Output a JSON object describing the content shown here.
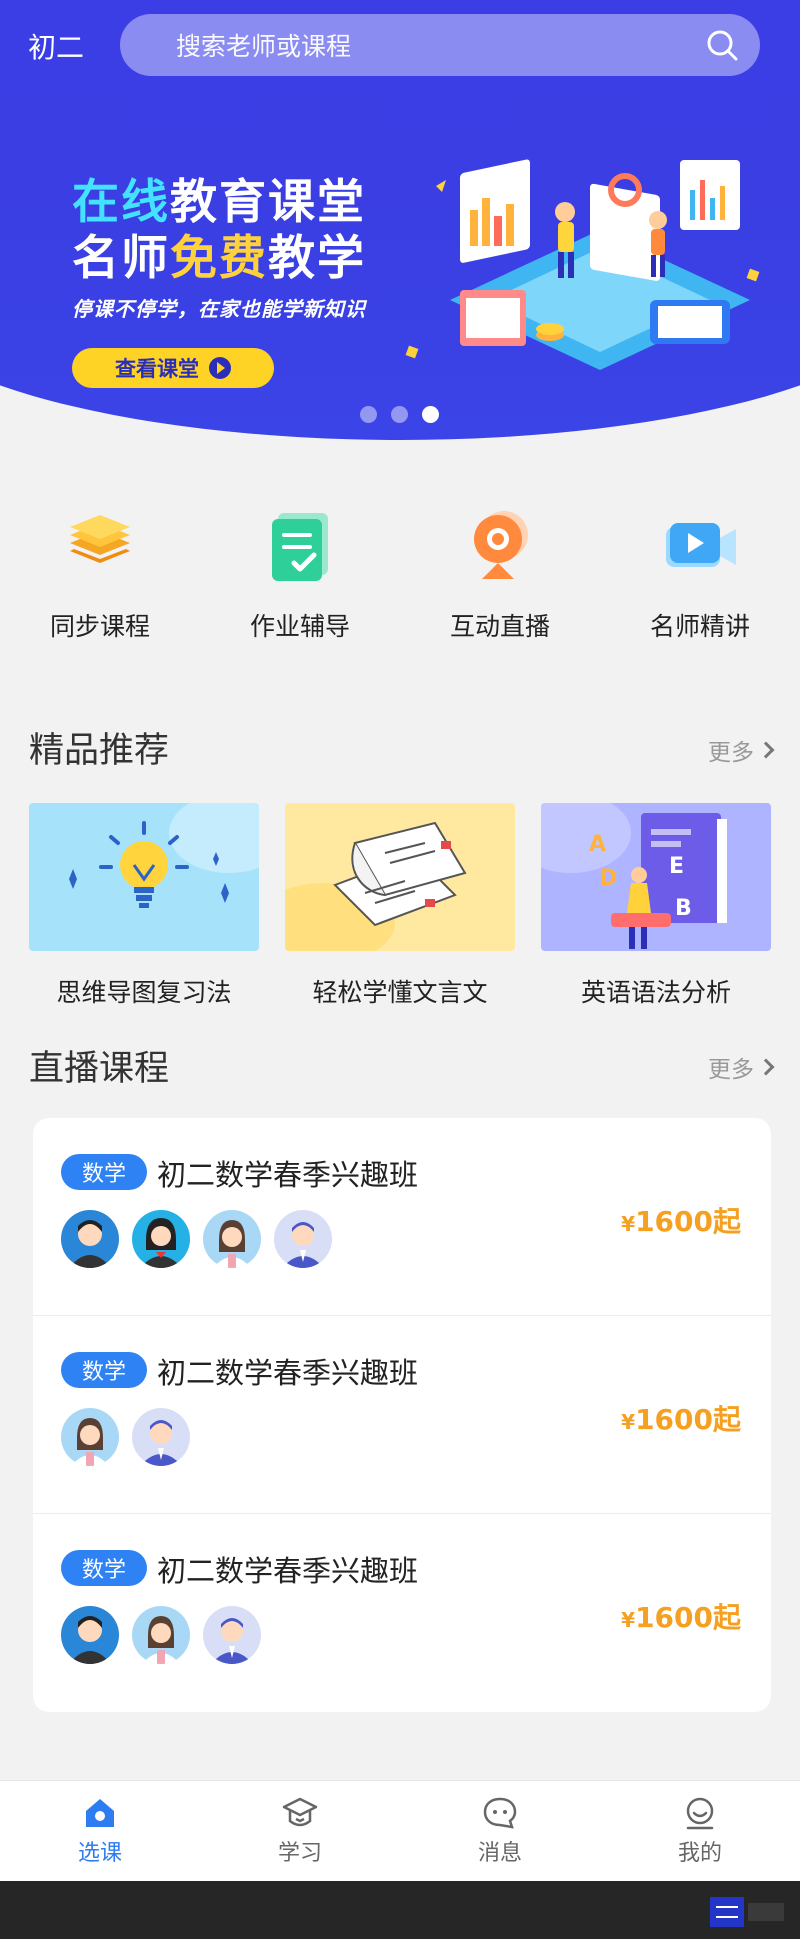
{
  "header": {
    "grade": "初二",
    "search_placeholder": "搜索老师或课程"
  },
  "banner": {
    "line1_a": "在线",
    "line1_b": "教育课堂",
    "line2_a": "名师",
    "line2_b": "免费",
    "line2_c": "教学",
    "subtitle": "停课不停学，在家也能学新知识",
    "button": "查看课堂",
    "dots_total": 3,
    "dots_active": 3
  },
  "categories": [
    {
      "label": "同步课程",
      "icon": "stack-layers-icon"
    },
    {
      "label": "作业辅导",
      "icon": "checklist-icon"
    },
    {
      "label": "互动直播",
      "icon": "webcam-icon"
    },
    {
      "label": "名师精讲",
      "icon": "video-camera-icon"
    }
  ],
  "recommend": {
    "title": "精品推荐",
    "more": "更多",
    "items": [
      {
        "name": "思维导图复习法",
        "icon": "lightbulb-icon"
      },
      {
        "name": "轻松学懂文言文",
        "icon": "open-book-icon"
      },
      {
        "name": "英语语法分析",
        "icon": "alphabet-book-icon"
      }
    ]
  },
  "live": {
    "title": "直播课程",
    "more": "更多",
    "courses": [
      {
        "tag": "数学",
        "title": "初二数学春季兴趣班",
        "currency": "¥",
        "price": "1600起",
        "teachers": 4
      },
      {
        "tag": "数学",
        "title": "初二数学春季兴趣班",
        "currency": "¥",
        "price": "1600起",
        "teachers": 2
      },
      {
        "tag": "数学",
        "title": "初二数学春季兴趣班",
        "currency": "¥",
        "price": "1600起",
        "teachers": 3
      }
    ]
  },
  "tabs": [
    {
      "label": "选课",
      "icon": "home-icon",
      "active": true
    },
    {
      "label": "学习",
      "icon": "graduation-cap-icon",
      "active": false
    },
    {
      "label": "消息",
      "icon": "chat-bubble-icon",
      "active": false
    },
    {
      "label": "我的",
      "icon": "user-face-icon",
      "active": false
    }
  ],
  "colors": {
    "brand_blue": "#3c3fe6",
    "accent_blue": "#2f82f3",
    "price_orange": "#f5a020",
    "button_yellow": "#ffd326"
  }
}
